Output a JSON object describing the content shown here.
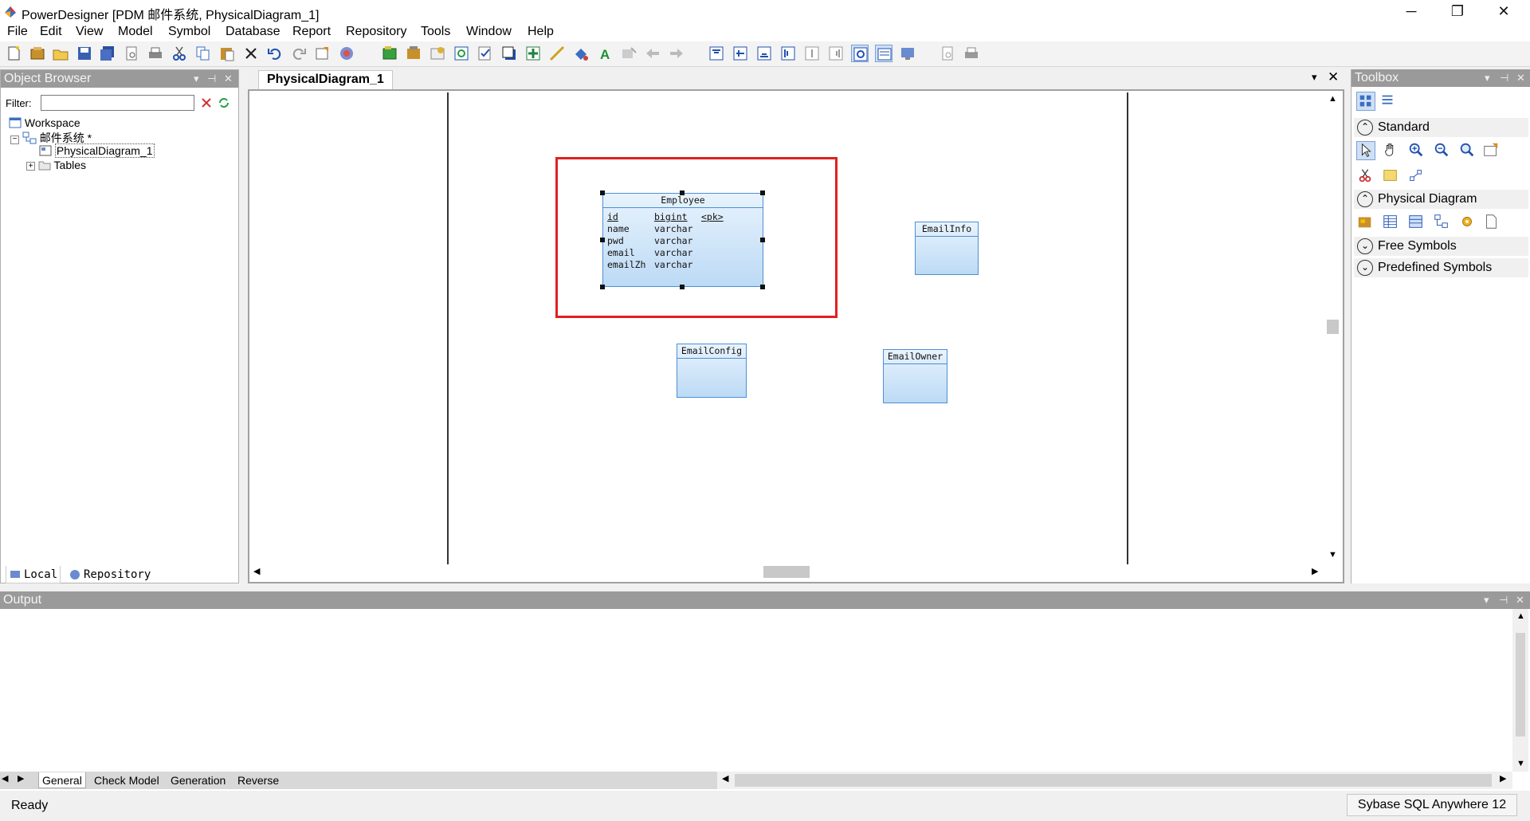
{
  "window": {
    "title": "PowerDesigner [PDM 邮件系统, PhysicalDiagram_1]",
    "minimize": "─",
    "restore": "❐",
    "close": "✕"
  },
  "menu": [
    "File",
    "Edit",
    "View",
    "Model",
    "Symbol",
    "Database",
    "Report",
    "Repository",
    "Tools",
    "Window",
    "Help"
  ],
  "object_browser": {
    "title": "Object Browser",
    "filter_label": "Filter:",
    "filter_value": "",
    "tree": {
      "workspace": "Workspace",
      "model": "邮件系统 *",
      "diagram": "PhysicalDiagram_1",
      "tables": "Tables"
    },
    "tabs": [
      "Local",
      "Repository"
    ]
  },
  "document": {
    "tab_label": "PhysicalDiagram_1"
  },
  "diagram": {
    "entities": [
      {
        "name": "Employee",
        "columns": [
          {
            "name": "id",
            "type": "bigint",
            "key": "<pk>"
          },
          {
            "name": "name",
            "type": "varchar",
            "key": ""
          },
          {
            "name": "pwd",
            "type": "varchar",
            "key": ""
          },
          {
            "name": "email",
            "type": "varchar",
            "key": ""
          },
          {
            "name": "emailZh",
            "type": "varchar",
            "key": ""
          }
        ]
      },
      {
        "name": "EmailInfo",
        "columns": []
      },
      {
        "name": "EmailConfig",
        "columns": []
      },
      {
        "name": "EmailOwner",
        "columns": []
      }
    ]
  },
  "toolbox": {
    "title": "Toolbox",
    "sections": [
      "Standard",
      "Physical Diagram",
      "Free Symbols",
      "Predefined Symbols"
    ]
  },
  "output": {
    "title": "Output",
    "tabs": [
      "General",
      "Check Model",
      "Generation",
      "Reverse"
    ]
  },
  "status": {
    "text": "Ready",
    "dbms": "Sybase SQL Anywhere 12"
  },
  "colors": {
    "accent": "#e02020",
    "entity_border": "#4e8fd1",
    "entity_fill": "#cfe5f9",
    "pane_header": "#9a9a9a"
  }
}
